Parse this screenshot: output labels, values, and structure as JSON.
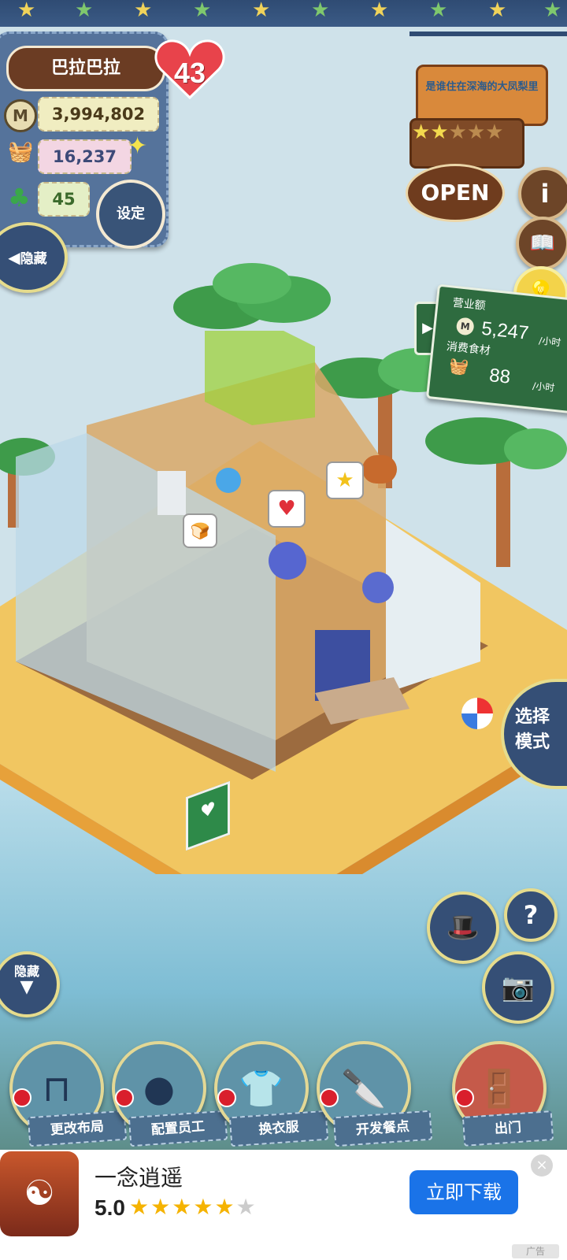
{
  "player": {
    "name": "巴拉巴拉",
    "level": "43",
    "coins": "3,994,802",
    "food": "16,237",
    "clovers": "45",
    "settings_label": "设定",
    "hide_label": "隐藏"
  },
  "shop_sign": {
    "motto": "是谁住在深海的大凤梨里",
    "status": "OPEN"
  },
  "revenue": {
    "revenue_label": "营业额",
    "revenue_value": "5,247",
    "revenue_unit": "/小时",
    "food_label": "消费食材",
    "food_value": "88",
    "food_unit": "/小时"
  },
  "side_controls": {
    "mode_label": "选择模式",
    "hide_label": "隐藏",
    "help_glyph": "?"
  },
  "actions": [
    {
      "label": "更改布局",
      "icon": "table-icon"
    },
    {
      "label": "配置员工",
      "icon": "mouse-head-icon"
    },
    {
      "label": "换衣服",
      "icon": "shirt-icon"
    },
    {
      "label": "开发餐点",
      "icon": "knife-icon"
    },
    {
      "label": "出门",
      "icon": "door-icon"
    }
  ],
  "ad": {
    "title": "一念逍遥",
    "rating": "5.0",
    "download_label": "立即下载",
    "tag": "广告",
    "stars_filled": 5,
    "stars_total": 6
  },
  "colors": {
    "denim": "#55739b",
    "button_border": "#e6dc8d",
    "ad_button": "#1a73e8",
    "revenue_board": "#2e6b3f"
  }
}
